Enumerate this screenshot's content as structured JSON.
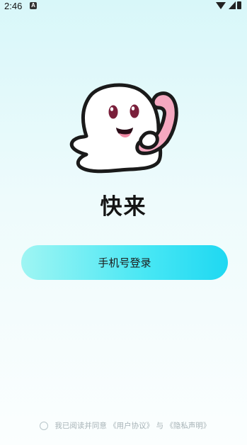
{
  "status_bar": {
    "time": "2:46",
    "notification_icon_letter": "A",
    "icons": [
      "wifi-icon",
      "signal-icon",
      "battery-icon"
    ]
  },
  "app": {
    "name": "快来",
    "brand_colors": {
      "ghost_outline": "#1a1a1a",
      "ghost_fill": "#ffffff",
      "phone": "#f5a8c0",
      "eyes": "#7a1f3b",
      "tongue": "#f28aa6",
      "button_gradient_start": "#9ff5f3",
      "button_gradient_end": "#1fd8f2"
    }
  },
  "login": {
    "phone_login_label": "手机号登录"
  },
  "agreement": {
    "prefix": "我已阅读并同意",
    "user_agreement": "《用户协议》",
    "joiner": "与",
    "privacy_policy": "《隐私声明》"
  }
}
